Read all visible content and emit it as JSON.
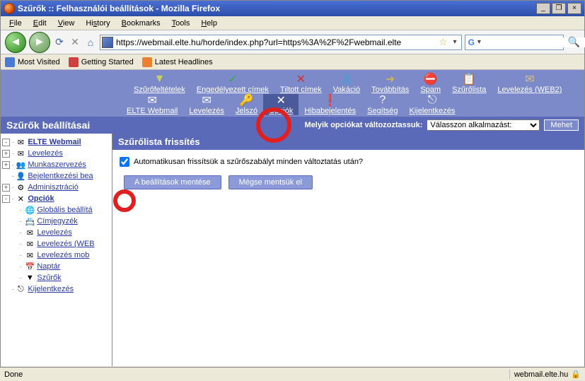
{
  "window": {
    "title": "Szűrők :: Felhasználói beállítások - Mozilla Firefox",
    "min": "_",
    "max": "▫",
    "restore": "❐",
    "close": "×"
  },
  "menu": {
    "file": "File",
    "edit": "Edit",
    "view": "View",
    "history": "History",
    "bookmarks": "Bookmarks",
    "tools": "Tools",
    "help": "Help"
  },
  "url": "https://webmail.elte.hu/horde/index.php?url=https%3A%2F%2Fwebmail.elte",
  "bookmarks": {
    "most": "Most Visited",
    "getting": "Getting Started",
    "latest": "Latest Headlines"
  },
  "toprow": [
    {
      "icon": "▼",
      "label": "Szűrőfeltételek",
      "color": "#c8d060"
    },
    {
      "icon": "✓",
      "label": "Engedélyezett címek",
      "color": "#30b030"
    },
    {
      "icon": "✕",
      "label": "Tiltott címek",
      "color": "#d03030"
    },
    {
      "icon": "🏝",
      "label": "Vakáció",
      "color": "#40a0d0"
    },
    {
      "icon": "➜",
      "label": "Továbbítás",
      "color": "#c8b060"
    },
    {
      "icon": "⛔",
      "label": "Spam",
      "color": "#888"
    },
    {
      "icon": "📋",
      "label": "Szűrőlista",
      "color": "#888"
    },
    {
      "icon": "✉",
      "label": "Levelezés (WEB2)",
      "color": "#d8c080"
    }
  ],
  "botrow": [
    {
      "icon": "✉",
      "label": "ELTE Webmail"
    },
    {
      "icon": "✉",
      "label": "Levelezés"
    },
    {
      "icon": "🔑",
      "label": "Jelszó"
    },
    {
      "icon": "✕",
      "label": "Opciók",
      "active": true
    },
    {
      "icon": "❗",
      "label": "Hibabejelentés"
    },
    {
      "icon": "?",
      "label": "Segítség"
    },
    {
      "icon": "⎋",
      "label": "Kijelentkezés"
    }
  ],
  "optbar": {
    "heading": "Szűrők beállításai",
    "question": "Melyik opciókat változoztassuk:",
    "select": "Válasszon alkalmazást:",
    "go": "Mehet"
  },
  "sidebar": [
    {
      "exp": "-",
      "icon": "mail",
      "label": "ELTE Webmail",
      "bold": true
    },
    {
      "exp": "+",
      "icon": "env",
      "label": "Levelezés"
    },
    {
      "exp": "+",
      "icon": "grp",
      "label": "Munkaszervezés"
    },
    {
      "exp": "",
      "icon": "usr",
      "label": "Bejelentkezési bea"
    },
    {
      "exp": "+",
      "icon": "adm",
      "label": "Adminisztráció"
    },
    {
      "exp": "-",
      "icon": "opt",
      "label": "Opciók",
      "bold": true
    },
    {
      "sub": true,
      "icon": "glb",
      "label": "Globális beállítá"
    },
    {
      "sub": true,
      "icon": "adr",
      "label": "Címjegyzék"
    },
    {
      "sub": true,
      "icon": "env",
      "label": "Levelezés"
    },
    {
      "sub": true,
      "icon": "env",
      "label": "Levelezés (WEB"
    },
    {
      "sub": true,
      "icon": "env",
      "label": "Levelezés mob"
    },
    {
      "sub": true,
      "icon": "cal",
      "label": "Naptár"
    },
    {
      "sub": true,
      "icon": "flt",
      "label": "Szűrők"
    },
    {
      "exp": "",
      "icon": "out",
      "label": "Kijelentkezés"
    }
  ],
  "panel": {
    "heading": "Szűrőlista frissítés",
    "chk_label": "Automatikusan frissítsük a szűrőszabályt minden változtatás után?",
    "save": "A beállítások mentése",
    "cancel": "Mégse mentsük el"
  },
  "status": {
    "left": "Done",
    "right": "webmail.elte.hu"
  }
}
